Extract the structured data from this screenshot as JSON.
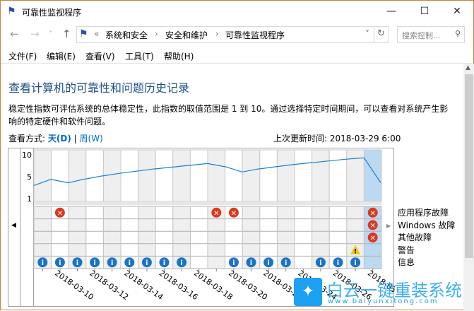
{
  "window": {
    "title": "可靠性监视程序",
    "minimize": "—",
    "maximize": "☐",
    "close": "✕"
  },
  "address": {
    "prefix": "«",
    "crumbs": [
      "系统和安全",
      "安全和维护",
      "可靠性监视程序"
    ],
    "search_placeholder": "搜索控制..."
  },
  "menu": [
    "文件(F)",
    "编辑(E)",
    "查看(V)",
    "工具(T)",
    "帮助(H)"
  ],
  "heading": "查看计算机的可靠性和问题历史记录",
  "description": [
    "稳定性指数可评估系统的总体稳定性，此指数的取值范围是 1 到 10。通过选择特定时间期间，可以查看对系统产生影",
    "响的特定硬件和软件问题。"
  ],
  "view": {
    "label": "查看方式:",
    "day": "天(D)",
    "sep": "|",
    "week": "周(W)",
    "last_update": "上次更新时间: 2018-03-29 6:00"
  },
  "chart_data": {
    "type": "line",
    "y_ticks": [
      "10",
      "5",
      "1"
    ],
    "dates": [
      "2018-03-09",
      "2018-03-10",
      "2018-03-11",
      "2018-03-12",
      "2018-03-13",
      "2018-03-14",
      "2018-03-15",
      "2018-03-16",
      "2018-03-17",
      "2018-03-18",
      "2018-03-19",
      "2018-03-20",
      "2018-03-21",
      "2018-03-22",
      "2018-03-23",
      "2018-03-24",
      "2018-03-25",
      "2018-03-26",
      "2018-03-27",
      "2018-03-28"
    ],
    "x_tick_labels": [
      "2018-03-10",
      "2018-03-12",
      "2018-03-14",
      "2018-03-16",
      "2018-03-18",
      "2018-03-20",
      "2018-03-22",
      "2018-03-24",
      "2018-03-26",
      "2018-03-28"
    ],
    "stability_index": [
      4.5,
      3.9,
      4.6,
      5.2,
      5.8,
      6.3,
      6.8,
      7.2,
      7.6,
      8.0,
      7.3,
      6.1,
      6.8,
      7.3,
      7.8,
      8.2,
      8.6,
      9.0,
      9.3,
      3.9
    ],
    "selected_date": "2018-03-28",
    "rows": [
      {
        "label": "应用程序故障",
        "type": "error",
        "days": [
          2,
          11,
          12,
          20
        ]
      },
      {
        "label": "Windows 故障",
        "type": "error",
        "days": [
          20
        ]
      },
      {
        "label": "其他故障",
        "type": "error",
        "days": [
          20
        ]
      },
      {
        "label": "警告",
        "type": "warning",
        "days": [
          19
        ]
      },
      {
        "label": "信息",
        "type": "info",
        "days": [
          1,
          2,
          3,
          4,
          5,
          6,
          7,
          8,
          9,
          12,
          13,
          14,
          15,
          17,
          18,
          19
        ]
      }
    ],
    "colors": {
      "line": "#1a7fd6",
      "selected": "#bcd9f2",
      "shade": "#efefef",
      "error": "#d9391f",
      "info": "#1a73c8",
      "warning": "#f7c600"
    }
  },
  "watermark": {
    "text": "白云一键重装系统",
    "url": "www.baiyunxitong.com"
  }
}
